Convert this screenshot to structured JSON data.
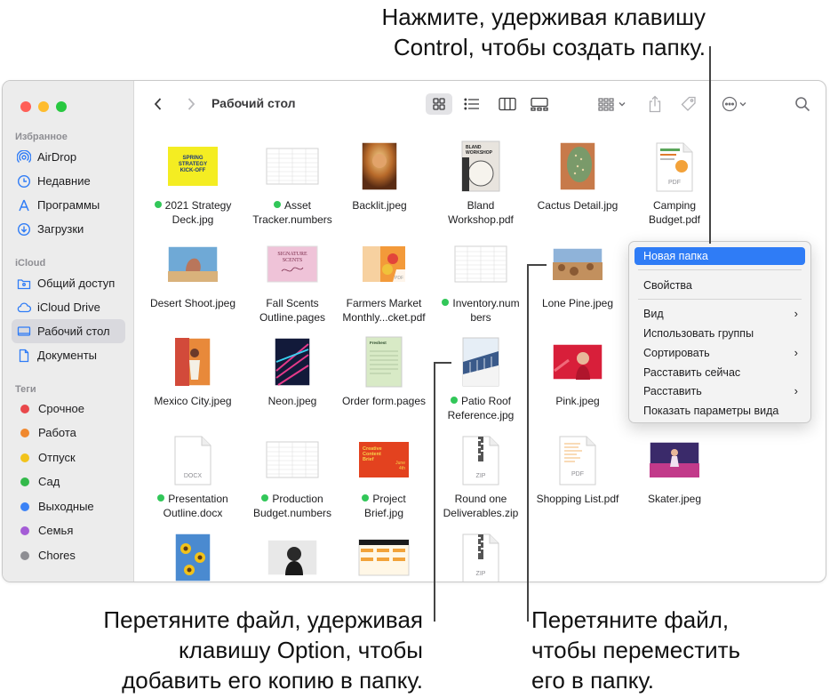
{
  "callouts": {
    "top": [
      "Нажмите, удерживая клавишу",
      "Control, чтобы создать папку."
    ],
    "left": [
      "Перетяните файл, удерживая",
      "клавишу Option, чтобы",
      "добавить его копию в папку."
    ],
    "right": [
      "Перетяните файл,",
      "чтобы переместить",
      "его в папку."
    ]
  },
  "sidebar": {
    "favorites_header": "Избранное",
    "favorites": [
      "AirDrop",
      "Недавние",
      "Программы",
      "Загрузки"
    ],
    "icloud_header": "iCloud",
    "icloud": [
      "Общий доступ",
      "iCloud Drive",
      "Рабочий стол",
      "Документы"
    ],
    "tags_header": "Теги",
    "tags": [
      {
        "label": "Срочное",
        "color": "#e9484b"
      },
      {
        "label": "Работа",
        "color": "#f0882e"
      },
      {
        "label": "Отпуск",
        "color": "#f2c31b"
      },
      {
        "label": "Сад",
        "color": "#33b94a"
      },
      {
        "label": "Выходные",
        "color": "#3b82f6"
      },
      {
        "label": "Семья",
        "color": "#a45cd6"
      },
      {
        "label": "Chores",
        "color": "#8e8e93"
      }
    ]
  },
  "toolbar": {
    "title": "Рабочий стол"
  },
  "files": [
    {
      "l1": "2021 Strategy",
      "l2": "Deck.jpg",
      "dot": true
    },
    {
      "l1": "Asset",
      "l2": "Tracker.numbers",
      "dot": true
    },
    {
      "l1": "Backlit.jpeg",
      "l2": "",
      "dot": false
    },
    {
      "l1": "Bland",
      "l2": "Workshop.pdf",
      "dot": false
    },
    {
      "l1": "Cactus Detail.jpg",
      "l2": "",
      "dot": false
    },
    {
      "l1": "Camping",
      "l2": "Budget.pdf",
      "dot": false
    },
    {
      "l1": "Desert Shoot.jpeg",
      "l2": "",
      "dot": false
    },
    {
      "l1": "Fall Scents",
      "l2": "Outline.pages",
      "dot": false
    },
    {
      "l1": "Farmers Market",
      "l2": "Monthly...cket.pdf",
      "dot": false
    },
    {
      "l1": "Inventory.num",
      "l2": "bers",
      "dot": true
    },
    {
      "l1": "Lone Pine.jpeg",
      "l2": "",
      "dot": false
    },
    {
      "l1": "Mexico City.jpeg",
      "l2": "",
      "dot": false
    },
    {
      "l1": "Neon.jpeg",
      "l2": "",
      "dot": false
    },
    {
      "l1": "Order form.pages",
      "l2": "",
      "dot": false
    },
    {
      "l1": "Patio Roof",
      "l2": "Reference.jpg",
      "dot": true
    },
    {
      "l1": "Pink.jpeg",
      "l2": "",
      "dot": false
    },
    {
      "l1": "Presentation",
      "l2": "Outline.docx",
      "dot": true
    },
    {
      "l1": "Production",
      "l2": "Budget.numbers",
      "dot": true
    },
    {
      "l1": "Project",
      "l2": "Brief.jpg",
      "dot": true
    },
    {
      "l1": "Round one",
      "l2": "Deliverables.zip",
      "dot": false
    },
    {
      "l1": "Shopping List.pdf",
      "l2": "",
      "dot": false
    },
    {
      "l1": "Skater.jpeg",
      "l2": "",
      "dot": false
    }
  ],
  "thumb_text": {
    "strategy": [
      "SPRING",
      "STRATEGY",
      "KICK-OFF"
    ],
    "bland": [
      "BLAND",
      "WORKSHOP"
    ],
    "signature": [
      "SIGNATURE",
      "SCENTS"
    ],
    "brief": [
      "Creative",
      "Content",
      "Brief",
      "June",
      "4th"
    ],
    "order": "Freshest",
    "pdf": "PDF",
    "docx": "DOCX",
    "zip": "ZIP"
  },
  "context_menu": {
    "items": [
      "Новая папка",
      "Свойства",
      "Вид",
      "Использовать группы",
      "Сортировать",
      "Расставить сейчас",
      "Расставить",
      "Показать параметры вида"
    ]
  }
}
